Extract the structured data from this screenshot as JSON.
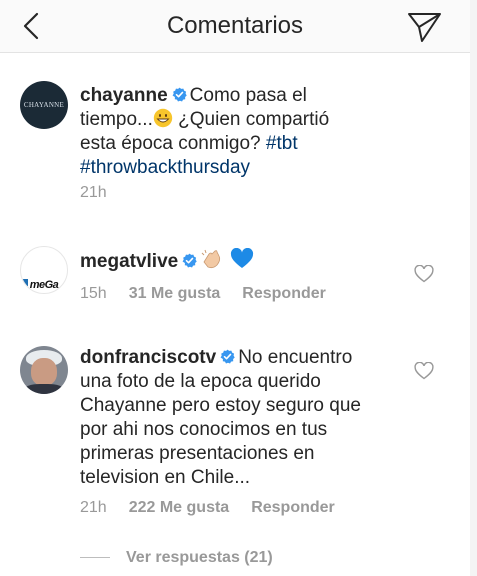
{
  "header": {
    "title": "Comentarios"
  },
  "icons": {
    "back": "chevron-left-icon",
    "send": "paper-plane-icon",
    "like": "heart-outline-icon",
    "verified": "verified-badge-icon"
  },
  "colors": {
    "verified": "#3897f0",
    "hashtag": "#003569",
    "meta": "#999999",
    "heart_emoji": "#1d8ae6"
  },
  "caption": {
    "avatar_text": "CHAYANNE",
    "username": "chayanne",
    "text_part1": "Como pasa el tiempo...",
    "text_part2": "¿Quien compartió esta época conmigo?",
    "hashtag1": "#tbt",
    "hashtag2": "#throwbackthursday",
    "time": "21h"
  },
  "comments": [
    {
      "avatar_text": "meGa",
      "username": "megatvlive",
      "emoji": "clapping hands, blue heart",
      "time": "15h",
      "likes": "31 Me gusta",
      "reply_label": "Responder"
    },
    {
      "username": "donfranciscotv",
      "text": "No encuentro una foto de la epoca querido Chayanne pero estoy seguro que por ahi nos conocimos en tus primeras presentaciones en television en Chile...",
      "time": "21h",
      "likes": "222 Me gusta",
      "reply_label": "Responder"
    }
  ],
  "view_replies": "Ver respuestas (21)"
}
